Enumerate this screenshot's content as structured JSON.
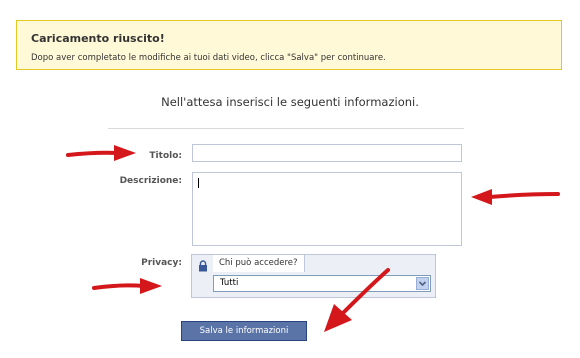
{
  "notice": {
    "title": "Caricamento riuscito!",
    "text": "Dopo aver completato le modifiche ai tuoi dati video, clicca \"Salva\" per continuare."
  },
  "heading": "Nell'attesa inserisci le seguenti informazioni.",
  "form": {
    "title_label": "Titolo:",
    "title_value": "",
    "description_label": "Descrizione:",
    "description_value": "",
    "privacy_label": "Privacy:",
    "privacy_tab": "Chi può accedere?",
    "privacy_selected": "Tutti"
  },
  "save_button": "Salva le informazioni",
  "colors": {
    "notice_bg": "#fff9d7",
    "notice_border": "#e2c822",
    "button_bg": "#5b74a8",
    "arrow": "#d3171b"
  },
  "icons": [
    "lock-icon",
    "chevron-down-icon",
    "red-arrow-icon"
  ]
}
